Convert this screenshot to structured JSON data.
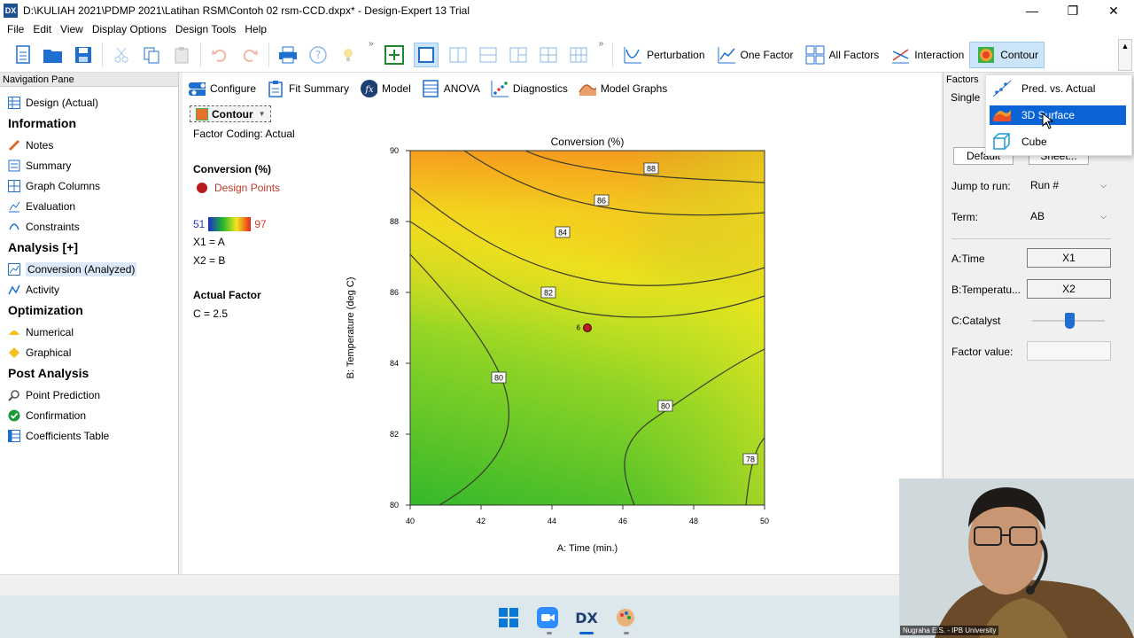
{
  "window": {
    "title": "D:\\KULIAH 2021\\PDMP 2021\\Latihan RSM\\Contoh 02 rsm-CCD.dxpx* - Design-Expert 13 Trial",
    "logo": "DX",
    "minimize": "—",
    "maximize": "❐",
    "close": "✕"
  },
  "menu": [
    "File",
    "Edit",
    "View",
    "Display Options",
    "Design Tools",
    "Help"
  ],
  "toolbar": {
    "more": "»",
    "graph_buttons": [
      {
        "label": "Perturbation",
        "icon": "perturbation-icon"
      },
      {
        "label": "One Factor",
        "icon": "one-factor-icon"
      },
      {
        "label": "All Factors",
        "icon": "all-factors-icon"
      },
      {
        "label": "Interaction",
        "icon": "interaction-icon"
      },
      {
        "label": "Contour",
        "icon": "contour-icon",
        "active": true
      }
    ]
  },
  "nav": {
    "header": "Navigation Pane",
    "design": "Design (Actual)",
    "sections": [
      {
        "title": "Information",
        "items": [
          "Notes",
          "Summary",
          "Graph Columns",
          "Evaluation",
          "Constraints"
        ]
      },
      {
        "title": "Analysis [+]",
        "items": [
          "Conversion (Analyzed)",
          "Activity"
        ]
      },
      {
        "title": "Optimization",
        "items": [
          "Numerical",
          "Graphical"
        ]
      },
      {
        "title": "Post Analysis",
        "items": [
          "Point Prediction",
          "Confirmation",
          "Coefficients Table"
        ]
      }
    ]
  },
  "tabs": [
    "Configure",
    "Fit Summary",
    "Model",
    "ANOVA",
    "Diagnostics",
    "Model Graphs"
  ],
  "graph_selector": "Contour",
  "info": {
    "factor_coding": "Factor Coding: Actual",
    "response": "Conversion (%)",
    "design_points": "Design Points",
    "range_low": "51",
    "range_high": "97",
    "x1": "X1 = A",
    "x2": "X2 = B",
    "actual_factor": "Actual Factor",
    "c_value": "C = 2.5"
  },
  "chart_data": {
    "type": "contour",
    "title": "Conversion (%)",
    "xlabel": "A: Time (min.)",
    "ylabel": "B: Temperature (deg C)",
    "xlim": [
      40,
      50
    ],
    "ylim": [
      80,
      90
    ],
    "xticks": [
      40,
      42,
      44,
      46,
      48,
      50
    ],
    "yticks": [
      80,
      82,
      84,
      86,
      88,
      90
    ],
    "contour_labels": [
      {
        "level": 88,
        "x": 46.8,
        "y": 89.5
      },
      {
        "level": 86,
        "x": 45.4,
        "y": 88.6
      },
      {
        "level": 84,
        "x": 44.3,
        "y": 87.7
      },
      {
        "level": 82,
        "x": 43.9,
        "y": 86.0
      },
      {
        "level": 80,
        "x": 42.5,
        "y": 83.6
      },
      {
        "level": 80,
        "x": 47.2,
        "y": 82.8
      },
      {
        "level": 78,
        "x": 49.6,
        "y": 81.3
      }
    ],
    "design_points": [
      {
        "x": 45,
        "y": 85,
        "label": "6"
      }
    ]
  },
  "right": {
    "header": "Factors",
    "single": "Single",
    "default_btn": "Default",
    "sheet_btn": "Sheet...",
    "jump_label": "Jump to run:",
    "jump_value": "Run #",
    "term_label": "Term:",
    "term_value": "AB",
    "a_label": "A:Time",
    "a_value": "X1",
    "b_label": "B:Temperatu...",
    "b_value": "X2",
    "c_label": "C:Catalyst",
    "c_slider": 0.5,
    "factor_value_label": "Factor value:",
    "factor_value": ""
  },
  "dropdown": [
    "Pred. vs. Actual",
    "3D Surface",
    "Cube"
  ],
  "webcam_name": "Nugraha E.S. - IPB University"
}
